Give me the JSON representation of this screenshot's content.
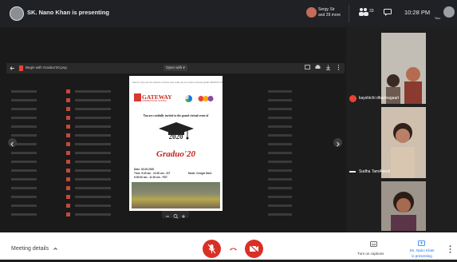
{
  "header": {
    "presenting_text": "SK. Nano Khan is presenting",
    "participant_line1": "Sergy Sir",
    "participant_line2": "and 29 more",
    "people_count": "33",
    "time": "10:28 PM",
    "you_label": "You"
  },
  "viewer": {
    "file_name": "Begin with Graduo'20.png",
    "open_with": "Open with ▾"
  },
  "invitation": {
    "header": "Step by step see the dreams of future and make all your plans succeed grade GRADUO 2020",
    "school_name": "GATEWAY",
    "school_sub": "INTERNATIONAL SCHOOL",
    "invite_text": "You are cordially invited to the grand virtual event of",
    "year": "2020",
    "event_title": "Graduo'20",
    "date": "Date: 30-09-2020",
    "time_line1": "Time: 9:30 am - 10:30 am - IST",
    "time_line2": "9:00:00 am - 11:00 am - PDT",
    "mode": "Mode: Google Meet"
  },
  "participants": [
    {
      "name": "kayshichi dharmagaarl"
    },
    {
      "name": "Sudha TamAleedi"
    },
    {
      "name": ""
    }
  ],
  "controls": {
    "meeting_details": "Meeting details",
    "captions": "Turn on captions",
    "present_line1": "SK. Nano Khan",
    "present_line2": "is presenting"
  },
  "colors": {
    "danger": "#d93025",
    "accent": "#1a73e8",
    "dark_bg": "#202124"
  }
}
